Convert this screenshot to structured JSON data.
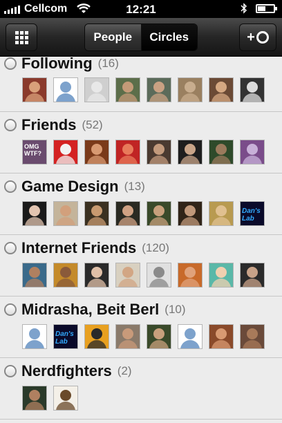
{
  "status_bar": {
    "carrier": "Cellcom",
    "time": "12:21",
    "icons": [
      "signal-icon",
      "wifi-icon",
      "bluetooth-icon",
      "battery-icon"
    ],
    "battery_level": 0.45
  },
  "nav": {
    "tabs": [
      {
        "label": "People",
        "selected": false
      },
      {
        "label": "Circles",
        "selected": true
      }
    ],
    "left_button_icon": "grid-icon",
    "right_button": {
      "label": "+",
      "icon": "circle-icon"
    }
  },
  "circles": [
    {
      "name": "Following",
      "count": "(16)",
      "avatars": [
        {
          "kind": "photo",
          "bg": "#8a3a2c",
          "skin": "#d9a07a"
        },
        {
          "kind": "placeholder"
        },
        {
          "kind": "photo",
          "bg": "#cfcfcf",
          "skin": "#e8e8e8"
        },
        {
          "kind": "photo",
          "bg": "#5c6e4a",
          "skin": "#c49a78"
        },
        {
          "kind": "photo",
          "bg": "#5b6b5a",
          "skin": "#c9a183"
        },
        {
          "kind": "photo",
          "bg": "#9a8060",
          "skin": "#c8ad8e"
        },
        {
          "kind": "photo",
          "bg": "#6b4a35",
          "skin": "#d5a882"
        },
        {
          "kind": "photo",
          "bg": "#333333",
          "skin": "#dddddd"
        }
      ]
    },
    {
      "name": "Friends",
      "count": "(52)",
      "avatars": [
        {
          "kind": "text",
          "bg": "#6a4b6e",
          "skin": "#b08a9a",
          "text": "OMG WTF?"
        },
        {
          "kind": "photo",
          "bg": "#d42222",
          "skin": "#f2f2f2"
        },
        {
          "kind": "photo",
          "bg": "#7a3a1a",
          "skin": "#d89a72"
        },
        {
          "kind": "photo",
          "bg": "#c02424",
          "skin": "#e87a5a"
        },
        {
          "kind": "photo",
          "bg": "#4a3a30",
          "skin": "#c29a7c"
        },
        {
          "kind": "photo",
          "bg": "#1e1e1e",
          "skin": "#c8a488"
        },
        {
          "kind": "photo",
          "bg": "#2e4a2a",
          "skin": "#9a7a5c"
        },
        {
          "kind": "photo",
          "bg": "#7a4c8a",
          "skin": "#c8b0d8"
        }
      ]
    },
    {
      "name": "Game Design",
      "count": "(13)",
      "avatars": [
        {
          "kind": "photo",
          "bg": "#1a1a1a",
          "skin": "#e2c4b0"
        },
        {
          "kind": "photo",
          "bg": "#c4b49a",
          "skin": "#d2a07c"
        },
        {
          "kind": "photo",
          "bg": "#3a3020",
          "skin": "#c89a70"
        },
        {
          "kind": "photo",
          "bg": "#2a2a22",
          "skin": "#d0a284"
        },
        {
          "kind": "photo",
          "bg": "#3a4a2a",
          "skin": "#c8a07c"
        },
        {
          "kind": "photo",
          "bg": "#302418",
          "skin": "#c0987a"
        },
        {
          "kind": "photo",
          "bg": "#b89a50",
          "skin": "#e0c090"
        },
        {
          "kind": "logo",
          "bg": "#0a0a2a",
          "skin": "#3aaaff",
          "text": "Dan's Lab"
        }
      ]
    },
    {
      "name": "Internet Friends",
      "count": "(120)",
      "avatars": [
        {
          "kind": "photo",
          "bg": "#3a6a8a",
          "skin": "#b08060"
        },
        {
          "kind": "photo",
          "bg": "#c48a2a",
          "skin": "#8a5a3a"
        },
        {
          "kind": "photo",
          "bg": "#2a2a2a",
          "skin": "#e0c0a8"
        },
        {
          "kind": "photo",
          "bg": "#d8d0c0",
          "skin": "#d2a684"
        },
        {
          "kind": "photo",
          "bg": "#e0e0e0",
          "skin": "#8a8a8a"
        },
        {
          "kind": "photo",
          "bg": "#c86a2a",
          "skin": "#e0a27a"
        },
        {
          "kind": "photo",
          "bg": "#5ab8a8",
          "skin": "#f0d0b0"
        },
        {
          "kind": "photo",
          "bg": "#2a2a2a",
          "skin": "#c8a288"
        }
      ]
    },
    {
      "name": "Midrasha, Beit Berl",
      "count": "(10)",
      "avatars": [
        {
          "kind": "placeholder"
        },
        {
          "kind": "logo",
          "bg": "#0a0a2a",
          "skin": "#3aaaff",
          "text": "Dan's Lab"
        },
        {
          "kind": "photo",
          "bg": "#e8a020",
          "skin": "#2a2a2a"
        },
        {
          "kind": "photo",
          "bg": "#8a7a6a",
          "skin": "#c89a7a"
        },
        {
          "kind": "photo",
          "bg": "#3a4a2a",
          "skin": "#c8a07c"
        },
        {
          "kind": "placeholder"
        },
        {
          "kind": "photo",
          "bg": "#8a4a2a",
          "skin": "#d89a72"
        },
        {
          "kind": "photo",
          "bg": "#6a4a3a",
          "skin": "#a87a5a"
        }
      ]
    },
    {
      "name": "Nerdfighters",
      "count": "(2)",
      "avatars": [
        {
          "kind": "photo",
          "bg": "#2a3a2a",
          "skin": "#b08060"
        },
        {
          "kind": "photo",
          "bg": "#f4f0e8",
          "skin": "#6a4a2a"
        }
      ]
    }
  ]
}
